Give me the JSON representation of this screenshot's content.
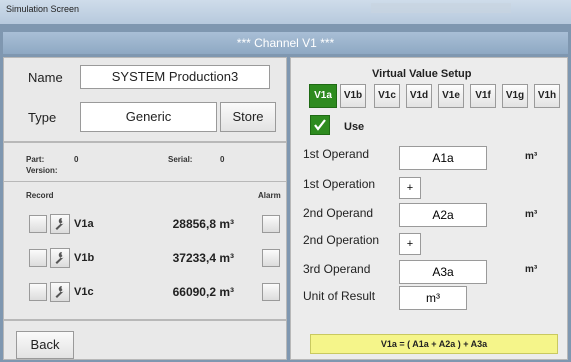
{
  "window": {
    "title": "Simulation Screen"
  },
  "header": {
    "title": "*** Channel V1 ***"
  },
  "left": {
    "name_label": "Name",
    "name_value": "SYSTEM Production3",
    "type_label": "Type",
    "type_value": "Generic",
    "store_label": "Store",
    "part_label": "Part:",
    "part_value": "0",
    "serial_label": "Serial:",
    "serial_value": "0",
    "version_label": "Version:",
    "record_label": "Record",
    "alarm_label": "Alarm",
    "rows": [
      {
        "name": "V1a",
        "value": "28856,8 m³"
      },
      {
        "name": "V1b",
        "value": "37233,4 m³"
      },
      {
        "name": "V1c",
        "value": "66090,2 m³"
      }
    ],
    "back_label": "Back"
  },
  "right": {
    "setup_title": "Virtual Value Setup",
    "tabs": [
      "V1a",
      "V1b",
      "V1c",
      "V1d",
      "V1e",
      "V1f",
      "V1g",
      "V1h"
    ],
    "active_tab": "V1a",
    "use_label": "Use",
    "use_checked": true,
    "operand1_label": "1st Operand",
    "operand1_value": "A1a",
    "operand1_unit": "m³",
    "operation1_label": "1st Operation",
    "operation1_value": "+",
    "operand2_label": "2nd Operand",
    "operand2_value": "A2a",
    "operand2_unit": "m³",
    "operation2_label": "2nd Operation",
    "operation2_value": "+",
    "operand3_label": "3rd Operand",
    "operand3_value": "A3a",
    "operand3_unit": "m³",
    "unit_label": "Unit of Result",
    "unit_value": "m³",
    "formula": "V1a = ( A1a + A2a ) + A3a"
  },
  "colors": {
    "active_tab": "#2e8b1f",
    "formula_bg": "#f5f58a",
    "header_bar": "#9bb3cc"
  }
}
